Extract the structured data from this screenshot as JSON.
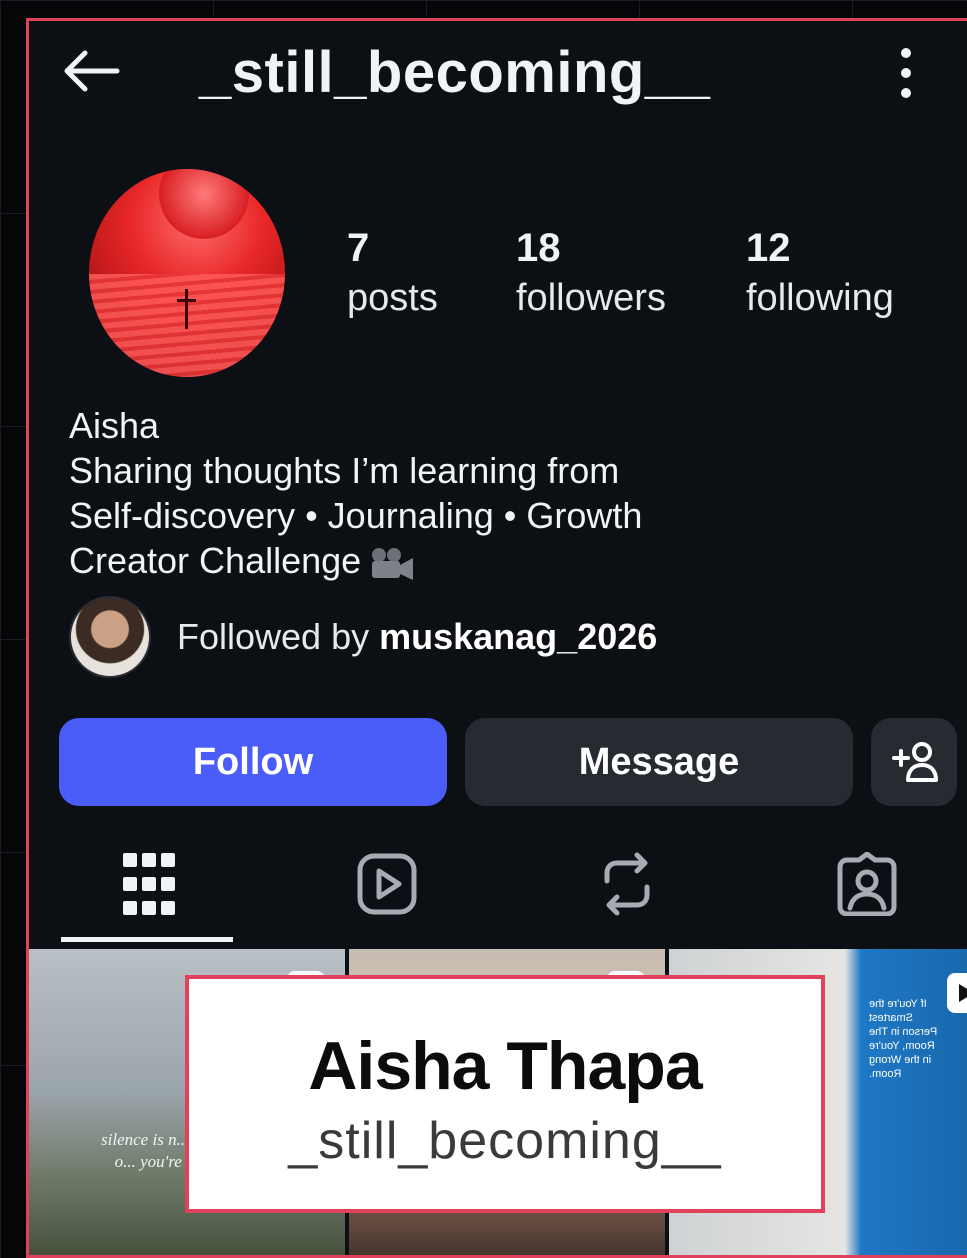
{
  "header": {
    "title": "_still_becoming__",
    "back_icon": "arrow-left-icon",
    "menu_icon": "more-vertical-icon"
  },
  "profile": {
    "stats": [
      {
        "value": "7",
        "label": "posts"
      },
      {
        "value": "18",
        "label": "followers"
      },
      {
        "value": "12",
        "label": "following"
      }
    ],
    "bio": {
      "name": "Aisha",
      "line1": "Sharing thoughts I’m learning from",
      "line2": "Self-discovery • Journaling • Growth",
      "line3": "Creator Challenge"
    },
    "followed_by": {
      "prefix": "Followed by ",
      "username": "muskanag_2026"
    }
  },
  "actions": {
    "follow_label": "Follow",
    "message_label": "Message"
  },
  "tabs": [
    "grid-icon",
    "reels-icon",
    "reposts-icon",
    "tagged-icon"
  ],
  "posts": {
    "post1_text": "silence is n... way o... you're n...",
    "post3_text": "If You're the Smartest Person in The Room, You're in the Wrong Room."
  },
  "overlay": {
    "full_name": "Aisha Thapa",
    "handle": "_still_becoming__"
  },
  "colors": {
    "accent": "#4a5df9",
    "border": "#e0425c",
    "background": "#0c0f14",
    "button_dark": "#262a31"
  }
}
